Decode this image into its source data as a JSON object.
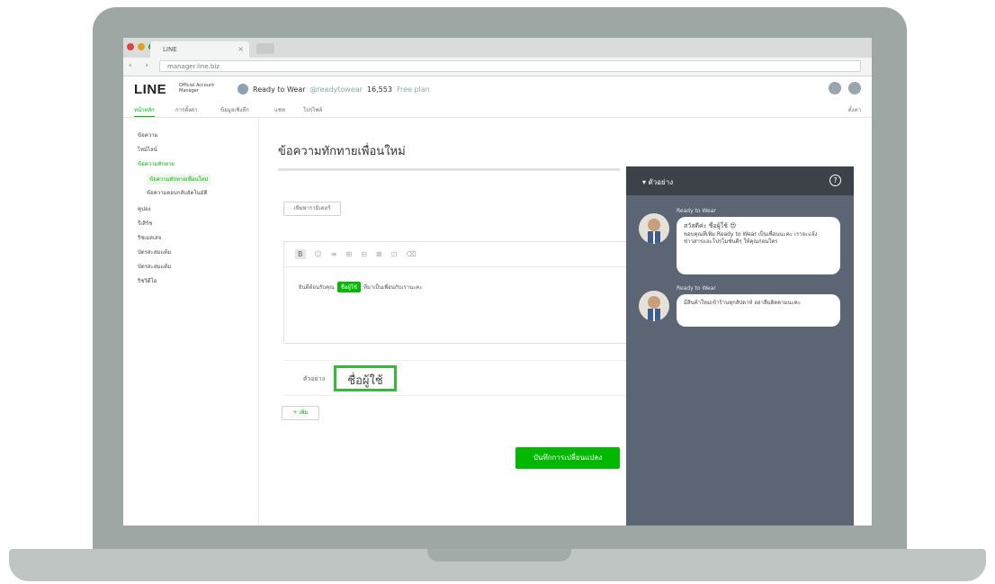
{
  "browser": {
    "tab_title": "LINE",
    "tab_close": "×",
    "nav_buttons": "‹ › ↻",
    "url": "manager.line.biz"
  },
  "header": {
    "logo": "LINE",
    "logo_sub": "Official Account Manager",
    "account_name": "Ready to Wear",
    "account_id": "@readytowear",
    "friend_count": "16,553",
    "plan": "Free plan"
  },
  "navtabs": {
    "items": [
      "หน้าหลัก",
      "การตั้งค่า",
      "ข้อมูลเชิงลึก",
      "แชท",
      "โปรไฟล์"
    ],
    "right": "ตั้งค่า"
  },
  "sidebar": {
    "items": [
      {
        "label": "ข้อความ",
        "active": false,
        "sub": false
      },
      {
        "label": "ไทม์ไลน์",
        "active": false,
        "sub": false
      },
      {
        "label": "ข้อความทักทาย",
        "active": true,
        "sub": false
      },
      {
        "label": "ข้อความทักทายเพื่อนใหม่",
        "active": true,
        "sub": true
      },
      {
        "label": "ข้อความตอบกลับอัตโนมัติ",
        "active": false,
        "sub": true
      },
      {
        "label": "คูปอง",
        "active": false,
        "sub": false
      },
      {
        "label": "รีเสิร์ช",
        "active": false,
        "sub": false
      },
      {
        "label": "ริชเมสเสจ",
        "active": false,
        "sub": false
      },
      {
        "label": "บัตรสะสมแต้ม",
        "active": false,
        "sub": false
      },
      {
        "label": "บัตรสะสมแต้ม",
        "active": false,
        "sub": false
      },
      {
        "label": "ริชวิดีโอ",
        "active": false,
        "sub": false
      }
    ]
  },
  "main": {
    "page_title": "ข้อความทักทายเพื่อนใหม่",
    "tag_button": "เพิ่มพารามิเตอร์",
    "toolbar": [
      "B",
      "☺",
      "≡",
      "⊞",
      "⊟",
      "⊠",
      "⊡",
      "⌫"
    ],
    "editor_text_before": "ยินดีต้อนรับคุณ",
    "editor_chip": "ชื่อผู้ใช้",
    "editor_text_after": "ที่มาเป็นเพื่อนกับเรานะคะ",
    "field_label": "ตัวอย่าง",
    "field_value": "ชื่อผู้ใช้",
    "add_button": "+ เพิ่ม",
    "save_button": "บันทึกการเปลี่ยนแปลง"
  },
  "preview": {
    "title": "▾ ตัวอย่าง",
    "help": "?",
    "messages": [
      {
        "name": "Ready to Wear",
        "heading": "สวัสดีค่ะ ชื่อผู้ใช้ 😍",
        "text": "ขอบคุณที่เพิ่ม Ready to Wear เป็นเพื่อนนะคะ เราจะแจ้งข่าวสารและโปรโมชั่นดีๆ ให้คุณก่อนใคร"
      },
      {
        "name": "Ready to Wear",
        "heading": "",
        "text": "มีสินค้าใหม่เข้าร้านทุกสัปดาห์ อย่าลืมติดตามนะคะ"
      }
    ]
  }
}
